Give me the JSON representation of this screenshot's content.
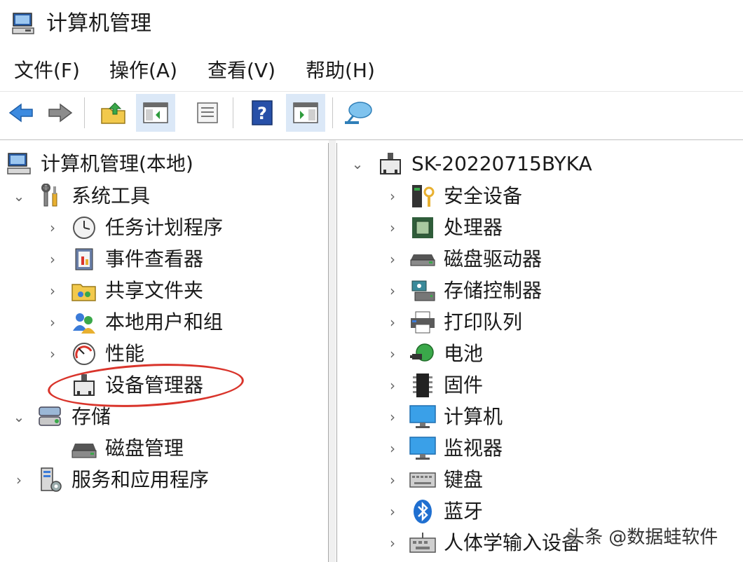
{
  "window": {
    "title": "计算机管理"
  },
  "menu": {
    "file": "文件(F)",
    "action": "操作(A)",
    "view": "查看(V)",
    "help": "帮助(H)"
  },
  "toolbar": {
    "buttons": [
      "back-arrow-icon",
      "forward-arrow-icon",
      "up-folder-icon",
      "show-hide-tree-icon",
      "properties-icon",
      "help-icon",
      "show-hide-action-pane-icon",
      "connect-computer-icon"
    ]
  },
  "tree": {
    "root": "计算机管理(本地)",
    "system_tools": "系统工具",
    "task_scheduler": "任务计划程序",
    "event_viewer": "事件查看器",
    "shared_folders": "共享文件夹",
    "local_users": "本地用户和组",
    "performance": "性能",
    "device_manager": "设备管理器",
    "storage": "存储",
    "disk_management": "磁盘管理",
    "services_apps": "服务和应用程序"
  },
  "devices": {
    "computer_name": "SK-20220715BYKA",
    "items": [
      "安全设备",
      "处理器",
      "磁盘驱动器",
      "存储控制器",
      "打印队列",
      "电池",
      "固件",
      "计算机",
      "监视器",
      "键盘",
      "蓝牙",
      "人体学输入设备"
    ]
  },
  "watermark": "头条 @数据蛙软件",
  "colors": {
    "highlight": "#d9342b",
    "accent": "#2a7fd4"
  }
}
